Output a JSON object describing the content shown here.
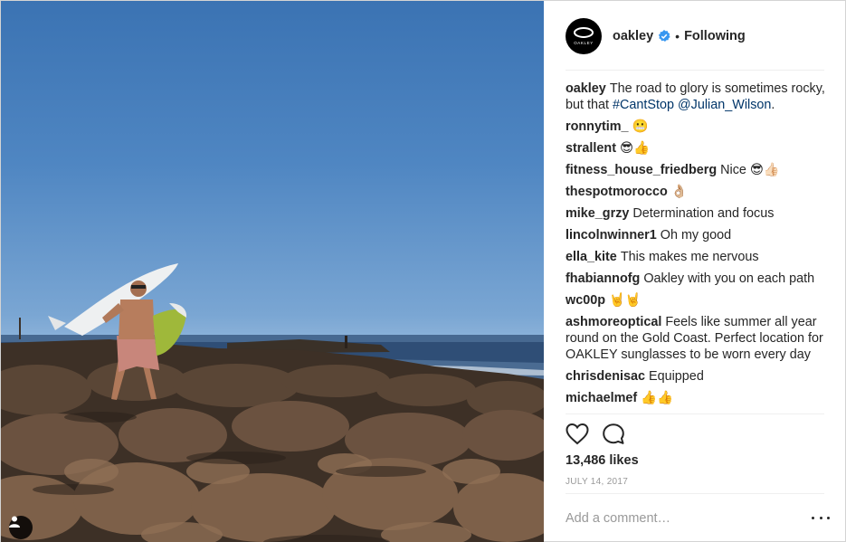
{
  "post": {
    "author": "oakley",
    "avatar_text": "OAKLEY",
    "separator": "•",
    "follow_status": "Following",
    "caption": {
      "author": "oakley",
      "text": "The road to glory is sometimes rocky, but that",
      "hashtag": "#CantStop",
      "mention": "@Julian_Wilson",
      "end": "."
    },
    "comments": [
      {
        "user": "ronnytim_",
        "text": "😬"
      },
      {
        "user": "strallent",
        "text": "😎👍"
      },
      {
        "user": "fitness_house_friedberg",
        "text": "Nice 😎👍🏻"
      },
      {
        "user": "thespotmorocco",
        "text": "👌🏼"
      },
      {
        "user": "mike_grzy",
        "text": "Determination and focus"
      },
      {
        "user": "lincolnwinner1",
        "text": "Oh my good"
      },
      {
        "user": "ella_kite",
        "text": "This makes me nervous"
      },
      {
        "user": "fhabiannofg",
        "text": "Oakley with you on each path"
      },
      {
        "user": "wc00p",
        "text": "🤘🤘"
      },
      {
        "user": "ashmoreoptical",
        "text": "Feels like summer all year round on the Gold Coast. Perfect location for OAKLEY sunglasses to be worn every day"
      },
      {
        "user": "chrisdenisac",
        "text": "Equipped"
      },
      {
        "user": "michaelmef",
        "text": "👍👍"
      }
    ],
    "likes": "13,486 likes",
    "date": "JULY 14, 2017",
    "comment_placeholder": "Add a comment…",
    "icons": {
      "like": "heart-outline-icon",
      "comment": "speech-bubble-icon",
      "more": "more-options-icon",
      "verified": "verified-badge-icon",
      "user_tag": "person-icon"
    },
    "colors": {
      "link": "#003569",
      "verified": "#3897f0",
      "text": "#262626",
      "muted": "#999999"
    }
  }
}
